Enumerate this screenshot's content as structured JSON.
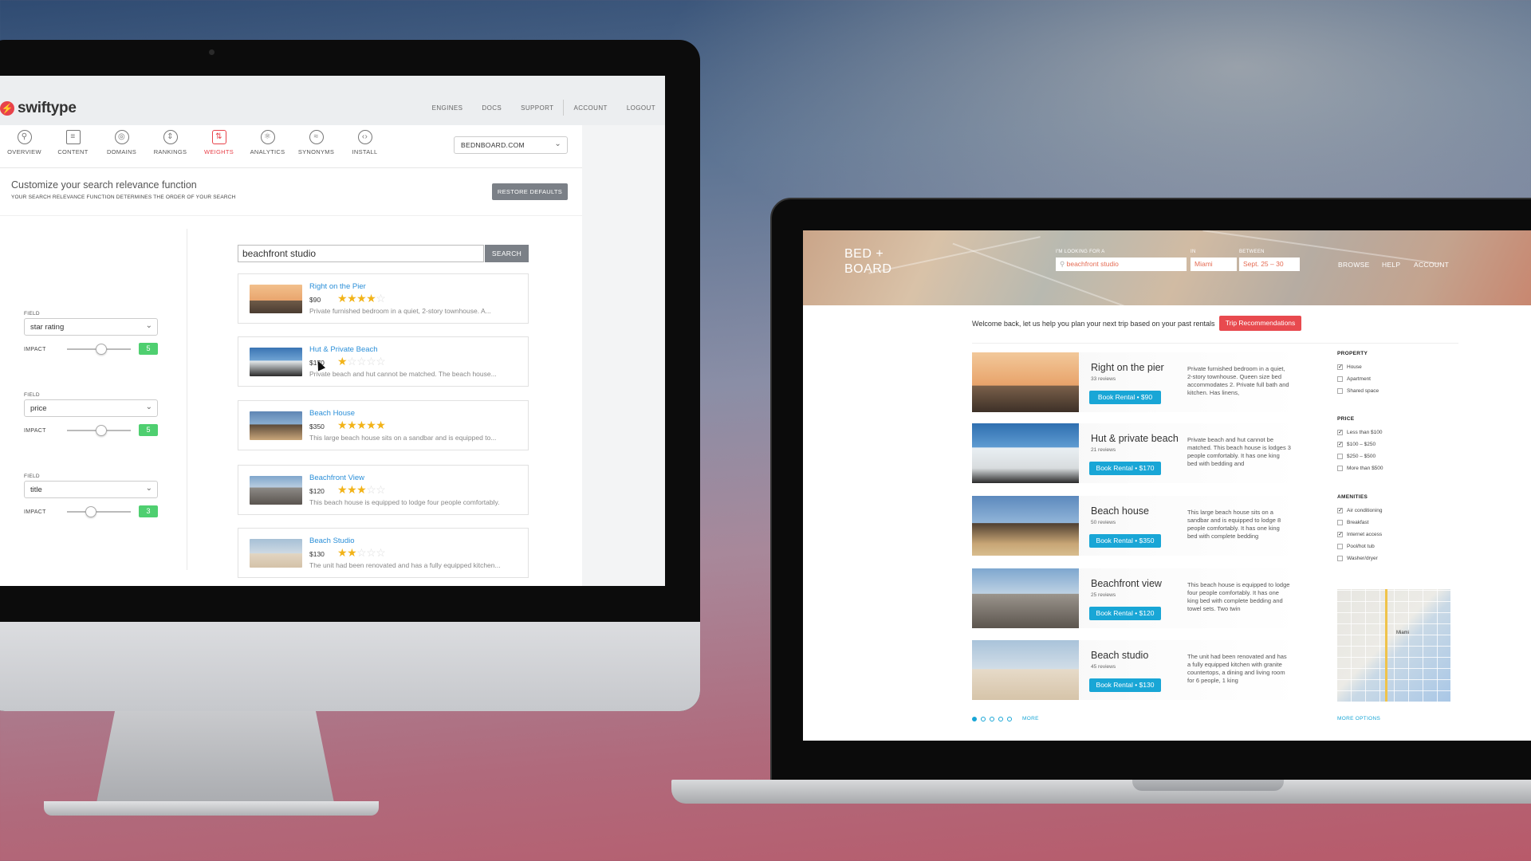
{
  "swiftype": {
    "logo": "swiftype",
    "top_nav": [
      "ENGINES",
      "DOCS",
      "SUPPORT",
      "ACCOUNT",
      "LOGOUT"
    ],
    "tabs": [
      {
        "label": "OVERVIEW",
        "icon": "magnifier-icon"
      },
      {
        "label": "CONTENT",
        "icon": "document-icon"
      },
      {
        "label": "DOMAINS",
        "icon": "target-icon"
      },
      {
        "label": "RANKINGS",
        "icon": "ranking-icon"
      },
      {
        "label": "WEIGHTS",
        "icon": "sliders-icon",
        "active": true
      },
      {
        "label": "ANALYTICS",
        "icon": "atom-icon"
      },
      {
        "label": "SYNONYMS",
        "icon": "approx-icon"
      },
      {
        "label": "INSTALL",
        "icon": "code-icon"
      }
    ],
    "domain_select": "BEDNBOARD.COM",
    "header": {
      "title": "Customize your search relevance function",
      "subtitle": "YOUR SEARCH RELEVANCE FUNCTION DETERMINES THE ORDER OF YOUR SEARCH",
      "restore_label": "RESTORE DEFAULTS"
    },
    "field_label": "FIELD",
    "impact_label": "IMPACT",
    "fields": [
      {
        "value": "star rating",
        "impact": "5",
        "slider_pct": 55
      },
      {
        "value": "price",
        "impact": "5",
        "slider_pct": 55
      },
      {
        "value": "title",
        "impact": "3",
        "slider_pct": 35
      }
    ],
    "search": {
      "value": "beachfront studio",
      "button": "SEARCH"
    },
    "results": [
      {
        "title": "Right on the Pier",
        "price": "$90",
        "stars": 4,
        "desc": "Private furnished bedroom in a quiet, 2-story townhouse. A..."
      },
      {
        "title": "Hut & Private Beach",
        "price": "$170",
        "stars": 1,
        "desc": "Private beach and hut cannot be matched. The beach house..."
      },
      {
        "title": "Beach House",
        "price": "$350",
        "stars": 5,
        "desc": "This large beach house sits on a sandbar and is equipped to..."
      },
      {
        "title": "Beachfront View",
        "price": "$120",
        "stars": 3,
        "desc": "This beach house is equipped to lodge four people comfortably."
      },
      {
        "title": "Beach Studio",
        "price": "$130",
        "stars": 2,
        "desc": "The unit had been renovated and has a fully equipped kitchen..."
      }
    ]
  },
  "bnb": {
    "logo_line1": "BED +",
    "logo_line2": "BOARD",
    "looking_label": "I'M LOOKING FOR A",
    "in_label": "IN",
    "between_label": "BETWEEN",
    "query": "beachfront studio",
    "location": "Miami",
    "dates": "Sept. 25 – 30",
    "nav": [
      "BROWSE",
      "HELP",
      "ACCOUNT"
    ],
    "welcome": "Welcome back, let us help you plan your next trip based on your past rentals",
    "trip_button": "Trip Recommendations",
    "listings": [
      {
        "name": "Right on the pier",
        "reviews": "33 reviews",
        "book": "Book Rental • $90",
        "desc": "Private furnished bedroom in a quiet, 2-story townhouse. Queen size bed accommodates 2. Private full bath and kitchen. Has linens,"
      },
      {
        "name": "Hut & private beach",
        "reviews": "21 reviews",
        "book": "Book Rental • $170",
        "desc": "Private beach and hut cannot be matched. This beach house is lodges 3 people comfortably. It has one king bed with bedding and"
      },
      {
        "name": "Beach house",
        "reviews": "50 reviews",
        "book": "Book Rental • $350",
        "desc": "This large beach house sits on a sandbar and is equipped to lodge 8 people comfortably. It has one king bed with complete bedding"
      },
      {
        "name": "Beachfront view",
        "reviews": "25 reviews",
        "book": "Book Rental • $120",
        "desc": "This beach house is equipped to lodge four people comfortably. It has one king bed with complete bedding and towel sets. Two twin"
      },
      {
        "name": "Beach studio",
        "reviews": "45 reviews",
        "book": "Book Rental • $130",
        "desc": "The unit had been renovated and has a fully equipped kitchen with granite countertops, a dining and living room for 6 people, 1 king"
      }
    ],
    "filters": {
      "property": {
        "title": "PROPERTY",
        "items": [
          {
            "label": "House",
            "checked": true
          },
          {
            "label": "Apartment",
            "checked": false
          },
          {
            "label": "Shared space",
            "checked": false
          }
        ]
      },
      "price": {
        "title": "PRICE",
        "items": [
          {
            "label": "Less than $100",
            "checked": true
          },
          {
            "label": "$100 – $250",
            "checked": true
          },
          {
            "label": "$250 – $500",
            "checked": false
          },
          {
            "label": "More than $500",
            "checked": false
          }
        ]
      },
      "amenities": {
        "title": "AMENITIES",
        "items": [
          {
            "label": "Air conditioning",
            "checked": true
          },
          {
            "label": "Breakfast",
            "checked": false
          },
          {
            "label": "Internet access",
            "checked": true
          },
          {
            "label": "Pool/hot tub",
            "checked": false
          },
          {
            "label": "Washer/dryer",
            "checked": false
          }
        ]
      }
    },
    "map_label": "Miami",
    "more_label": "MORE",
    "more_options": "MORE OPTIONS"
  },
  "colors": {
    "accent_red": "#e8424a",
    "accent_blue": "#19a6d6",
    "impact_green": "#4fcf70"
  }
}
